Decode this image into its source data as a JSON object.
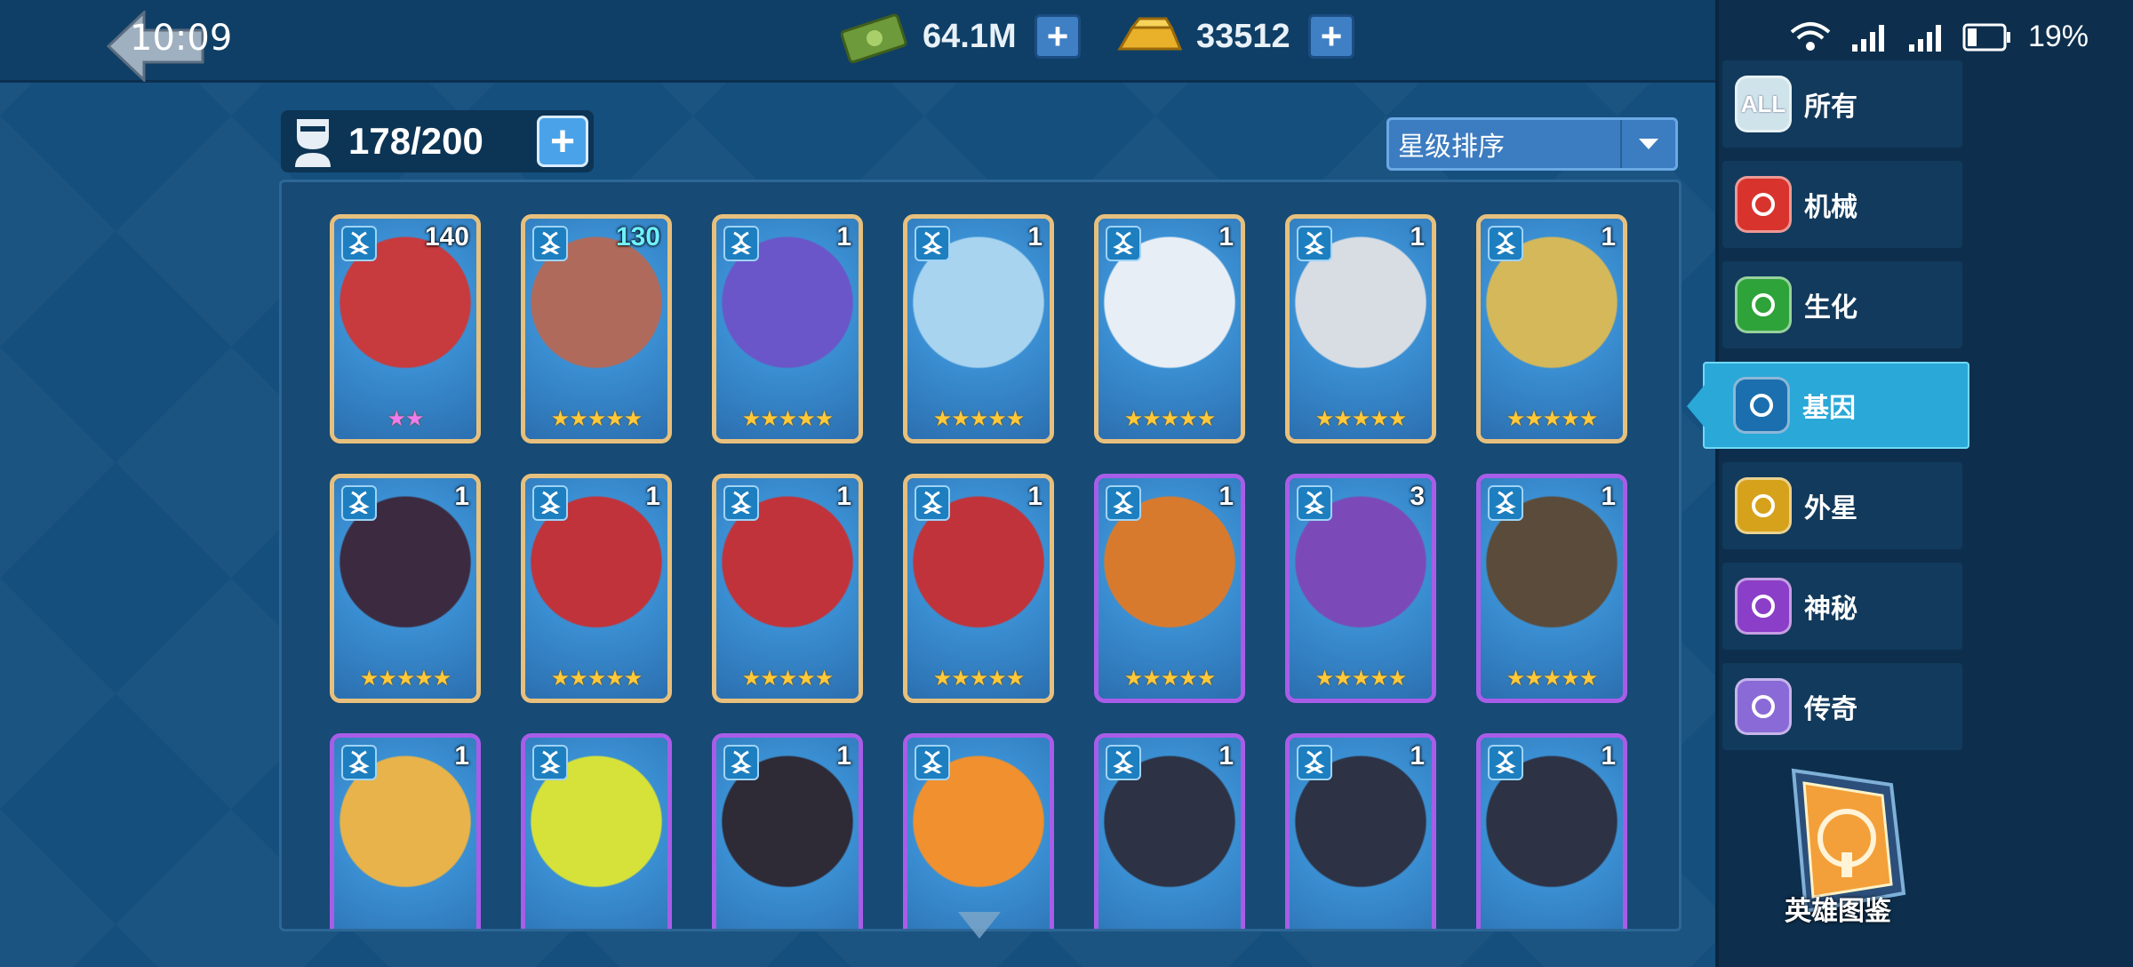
{
  "top": {
    "clock": "10:09",
    "money": "64.1M",
    "gold": "33512"
  },
  "status_bar": {
    "battery": "19%"
  },
  "capacity": "178/200",
  "sort": {
    "label": "星级排序"
  },
  "categories": [
    {
      "label": "所有",
      "icon_text": "ALL",
      "icon": "all-icon",
      "color": "#cfe3ea"
    },
    {
      "label": "机械",
      "icon": "mechanical-icon",
      "color": "#d8332d"
    },
    {
      "label": "生化",
      "icon": "biochem-flask-icon",
      "color": "#2ea33a"
    },
    {
      "label": "基因",
      "icon": "dna-icon",
      "color": "#1b6fae"
    },
    {
      "label": "外星",
      "icon": "alien-icon",
      "color": "#d6a21c"
    },
    {
      "label": "神秘",
      "icon": "mystic-eye-icon",
      "color": "#8b3ec7"
    },
    {
      "label": "传奇",
      "icon": "legend-wings-icon",
      "color": "#8a6ad6"
    }
  ],
  "active_category": "基因",
  "codex": {
    "label": "英雄图鉴"
  },
  "heroes": [
    {
      "level": "140",
      "stars": 2,
      "star_color": "pink",
      "frame": "gold",
      "art": "#c73a3e",
      "level_color": "white"
    },
    {
      "level": "130",
      "stars": 5,
      "frame": "gold",
      "art": "#b06a5b",
      "level_color": "cyan"
    },
    {
      "level": "1",
      "stars": 5,
      "frame": "gold",
      "art": "#6a56c8"
    },
    {
      "level": "1",
      "stars": 5,
      "frame": "gold",
      "art": "#a8d4f0"
    },
    {
      "level": "1",
      "stars": 5,
      "frame": "gold",
      "art": "#e8eef5"
    },
    {
      "level": "1",
      "stars": 5,
      "frame": "gold",
      "art": "#d8dde4"
    },
    {
      "level": "1",
      "stars": 5,
      "frame": "gold",
      "art": "#d5b85a"
    },
    {
      "level": "1",
      "stars": 5,
      "frame": "gold",
      "art": "#3c2a40"
    },
    {
      "level": "1",
      "stars": 5,
      "frame": "gold",
      "art": "#c0333a"
    },
    {
      "level": "1",
      "stars": 5,
      "frame": "gold",
      "art": "#c0333a"
    },
    {
      "level": "1",
      "stars": 5,
      "frame": "gold",
      "art": "#c0333a"
    },
    {
      "level": "1",
      "stars": 5,
      "frame": "purple",
      "art": "#d87a2e"
    },
    {
      "level": "3",
      "stars": 5,
      "frame": "purple",
      "art": "#7b4ab8"
    },
    {
      "level": "1",
      "stars": 5,
      "frame": "purple",
      "art": "#5b4b3a"
    },
    {
      "level": "1",
      "stars": 0,
      "frame": "purple",
      "art": "#e8b34a"
    },
    {
      "level": "",
      "stars": 0,
      "frame": "purple",
      "art": "#d6e23a"
    },
    {
      "level": "1",
      "stars": 0,
      "frame": "purple",
      "art": "#2e2a36"
    },
    {
      "level": "",
      "stars": 0,
      "frame": "purple",
      "art": "#f0902e"
    },
    {
      "level": "1",
      "stars": 0,
      "frame": "purple",
      "art": "#2d3245"
    },
    {
      "level": "1",
      "stars": 0,
      "frame": "purple",
      "art": "#2d3245"
    },
    {
      "level": "1",
      "stars": 0,
      "frame": "purple",
      "art": "#2d3245"
    }
  ]
}
